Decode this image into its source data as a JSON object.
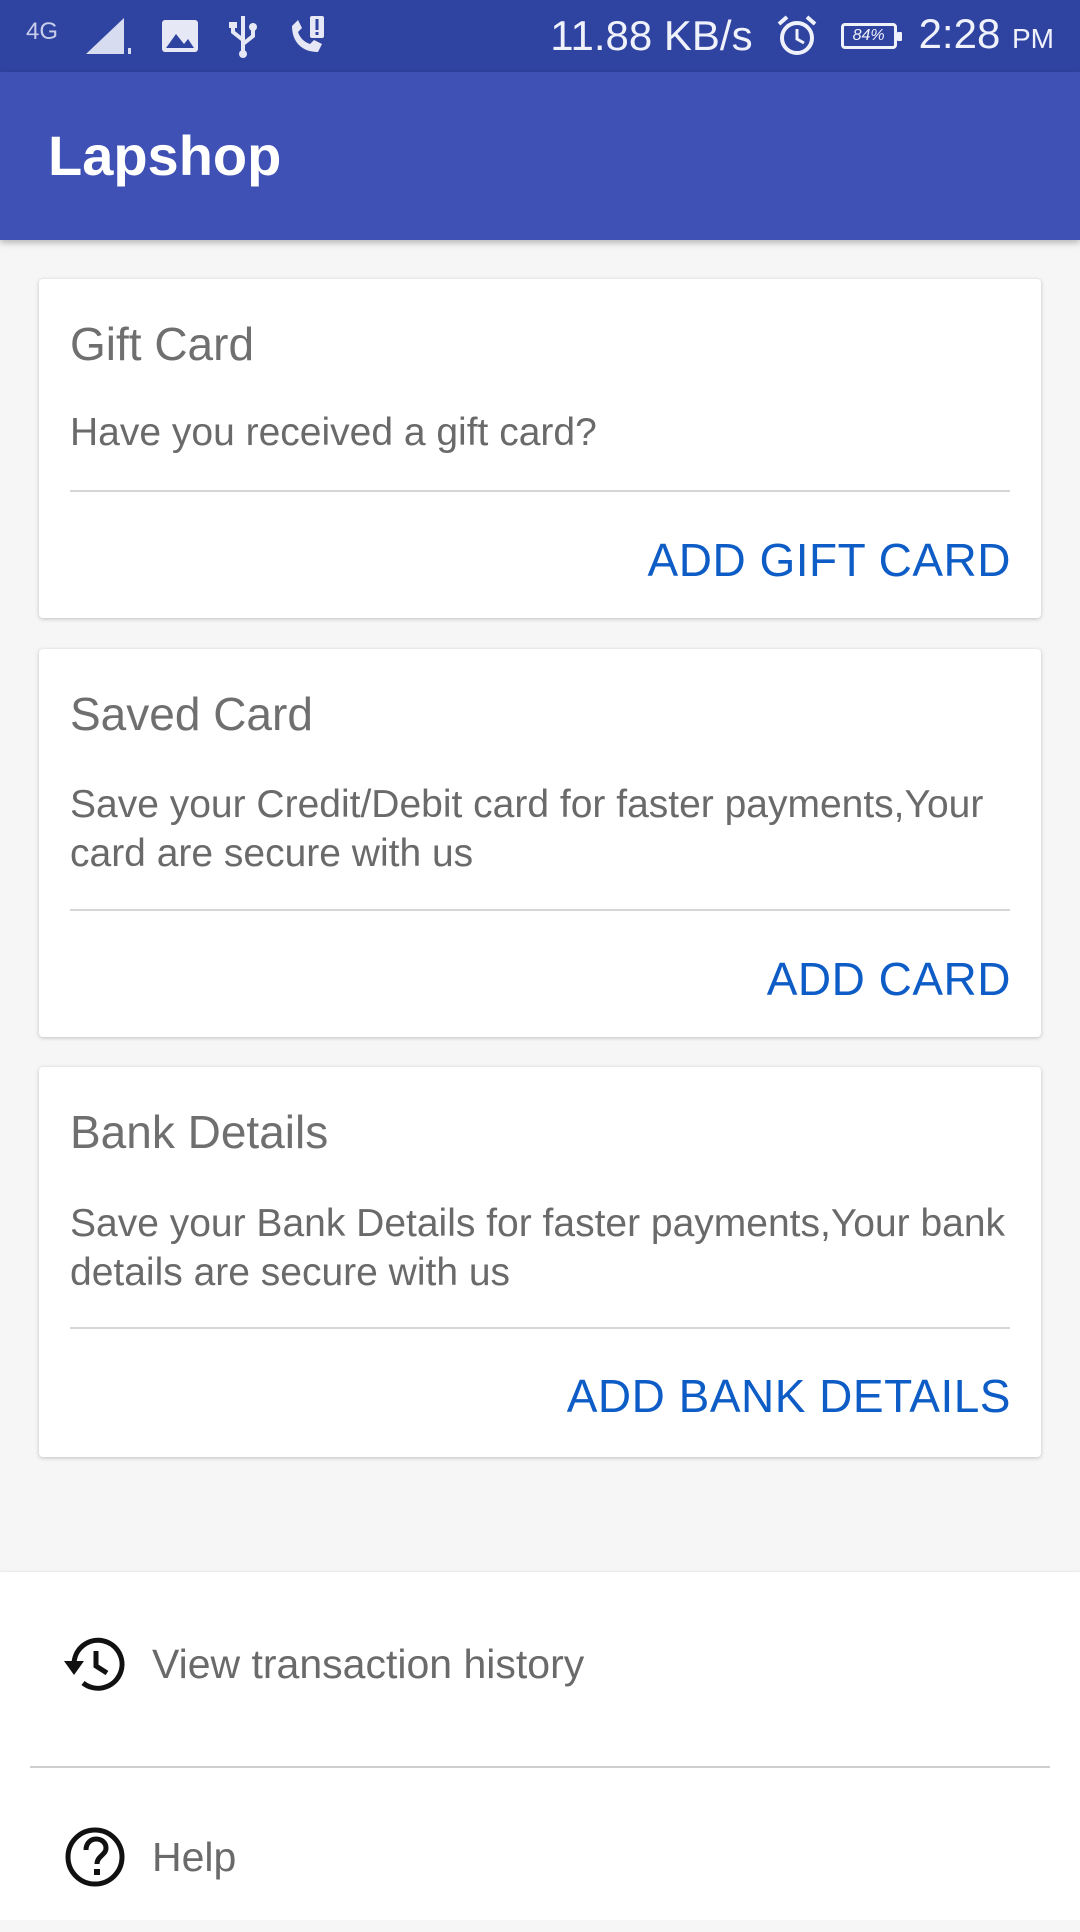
{
  "status_bar": {
    "network": "4G",
    "network_speed": "11.88 KB/s",
    "battery": "84%",
    "time": "2:28",
    "ampm": "PM"
  },
  "app_bar": {
    "title": "Lapshop"
  },
  "cards": [
    {
      "title": "Gift Card",
      "description": "Have you received a gift card?",
      "action": "ADD GIFT CARD"
    },
    {
      "title": "Saved Card",
      "description": "Save your Credit/Debit card for faster payments,Your card are secure with us",
      "action": "ADD CARD"
    },
    {
      "title": "Bank Details",
      "description": "Save your Bank Details for faster payments,Your bank details are secure with us",
      "action": "ADD BANK DETAILS"
    }
  ],
  "menu": [
    {
      "label": "View transaction history",
      "icon": "history-icon"
    },
    {
      "label": "Help",
      "icon": "help-icon"
    }
  ],
  "colors": {
    "status_bar": "#2f43a0",
    "primary": "#3f51b5",
    "accent": "#0e5cc6"
  }
}
